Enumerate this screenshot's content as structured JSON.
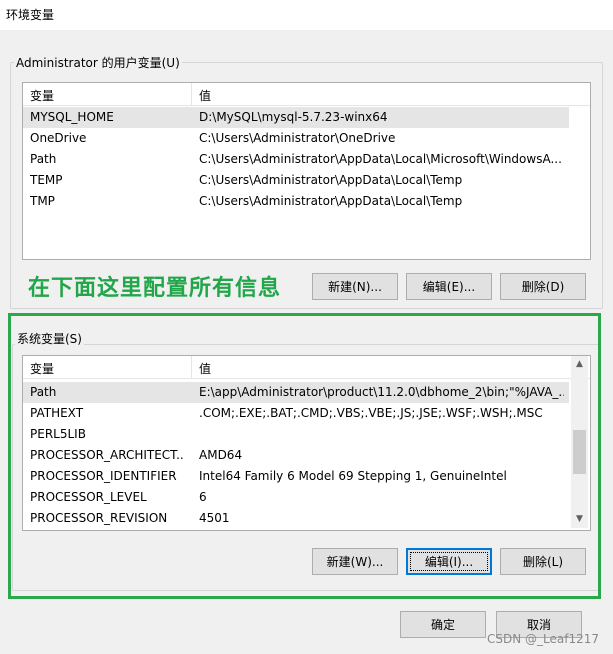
{
  "window": {
    "title": "环境变量"
  },
  "user_vars": {
    "group_label": "Administrator 的用户变量(U)",
    "col_name": "变量",
    "col_value": "值",
    "rows": [
      {
        "name": "MYSQL_HOME",
        "value": "D:\\MySQL\\mysql-5.7.23-winx64"
      },
      {
        "name": "OneDrive",
        "value": "C:\\Users\\Administrator\\OneDrive"
      },
      {
        "name": "Path",
        "value": "C:\\Users\\Administrator\\AppData\\Local\\Microsoft\\WindowsA..."
      },
      {
        "name": "TEMP",
        "value": "C:\\Users\\Administrator\\AppData\\Local\\Temp"
      },
      {
        "name": "TMP",
        "value": "C:\\Users\\Administrator\\AppData\\Local\\Temp"
      }
    ],
    "buttons": {
      "new": "新建(N)...",
      "edit": "编辑(E)...",
      "delete": "删除(D)"
    }
  },
  "annotation": "在下面这里配置所有信息",
  "system_vars": {
    "group_label": "系统变量(S)",
    "col_name": "变量",
    "col_value": "值",
    "rows": [
      {
        "name": "Path",
        "value": "E:\\app\\Administrator\\product\\11.2.0\\dbhome_2\\bin;\"%JAVA_..."
      },
      {
        "name": "PATHEXT",
        "value": ".COM;.EXE;.BAT;.CMD;.VBS;.VBE;.JS;.JSE;.WSF;.WSH;.MSC"
      },
      {
        "name": "PERL5LIB",
        "value": ""
      },
      {
        "name": "PROCESSOR_ARCHITECT...",
        "value": "AMD64"
      },
      {
        "name": "PROCESSOR_IDENTIFIER",
        "value": "Intel64 Family 6 Model 69 Stepping 1, GenuineIntel"
      },
      {
        "name": "PROCESSOR_LEVEL",
        "value": "6"
      },
      {
        "name": "PROCESSOR_REVISION",
        "value": "4501"
      }
    ],
    "buttons": {
      "new": "新建(W)...",
      "edit": "编辑(I)...",
      "delete": "删除(L)"
    }
  },
  "footer": {
    "ok": "确定",
    "cancel": "取消"
  },
  "watermark": "CSDN @_Leaf1217",
  "colors": {
    "annotation": "#22a64a",
    "focus_border": "#0078d7"
  }
}
